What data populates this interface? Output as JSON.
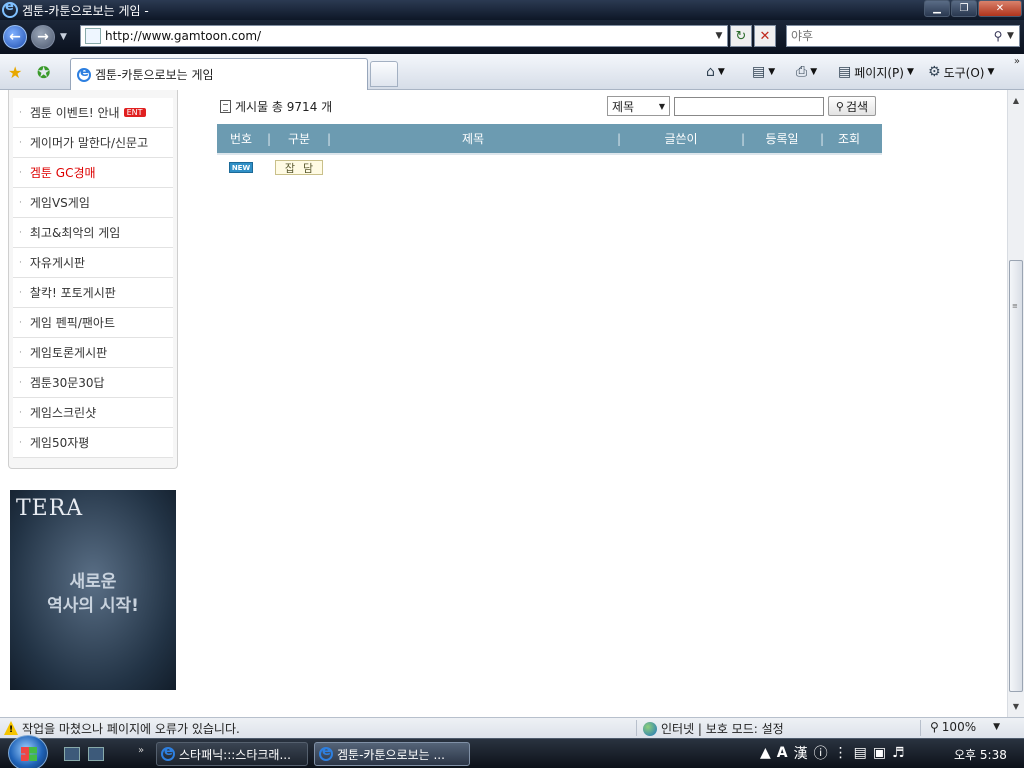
{
  "window": {
    "title": "겜툰-카툰으로보는 게임 -",
    "minimize_glyph": "▁",
    "restore_glyph": "❐",
    "close_glyph": "✕"
  },
  "addressbar": {
    "url": "http://www.gamtoon.com/",
    "search_placeholder": "야후"
  },
  "tabs": [
    {
      "label": "겜툰-카툰으로보는 게임"
    }
  ],
  "commandbar": {
    "page_label": "페이지(P)",
    "tools_label": "도구(O)"
  },
  "sidebar": {
    "items": [
      {
        "label": "겜툰 이벤트! 안내",
        "badge": "ENT"
      },
      {
        "label": "게이머가 말한다/신문고"
      },
      {
        "label": "겜툰 GC경매",
        "active": true
      },
      {
        "label": "게임VS게임"
      },
      {
        "label": "최고&최악의 게임"
      },
      {
        "label": "자유게시판"
      },
      {
        "label": "찰칵! 포토게시판"
      },
      {
        "label": "게임 펜픽/팬아트"
      },
      {
        "label": "게임토론게시판"
      },
      {
        "label": "겜툰30문30답"
      },
      {
        "label": "게임스크린샷"
      },
      {
        "label": "게임50자평"
      }
    ]
  },
  "ad": {
    "brand": "TERA",
    "slogan_line1": "새로운",
    "slogan_line2": "역사의 시작!"
  },
  "board": {
    "count_text": "게시물 총 9714 개",
    "search_field": "제목",
    "search_button": "검색",
    "columns": [
      "번호",
      "구분",
      "제목",
      "글쓴이",
      "등록일",
      "조회"
    ],
    "rows": [
      {
        "badge": "NEW",
        "category": "잡담"
      }
    ]
  },
  "statusbar": {
    "message": "작업을 마쳤으나 페이지에 오류가 있습니다.",
    "zone": "인터넷 | 보호 모드: 설정",
    "zoom": "100%"
  },
  "taskbar": {
    "tasks": [
      {
        "label": "스타패닉:::스타크래..."
      },
      {
        "label": "겜툰-카툰으로보는 ..."
      }
    ],
    "ime_label": "A",
    "hanja_label": "漢",
    "clock": "오후 5:38"
  }
}
